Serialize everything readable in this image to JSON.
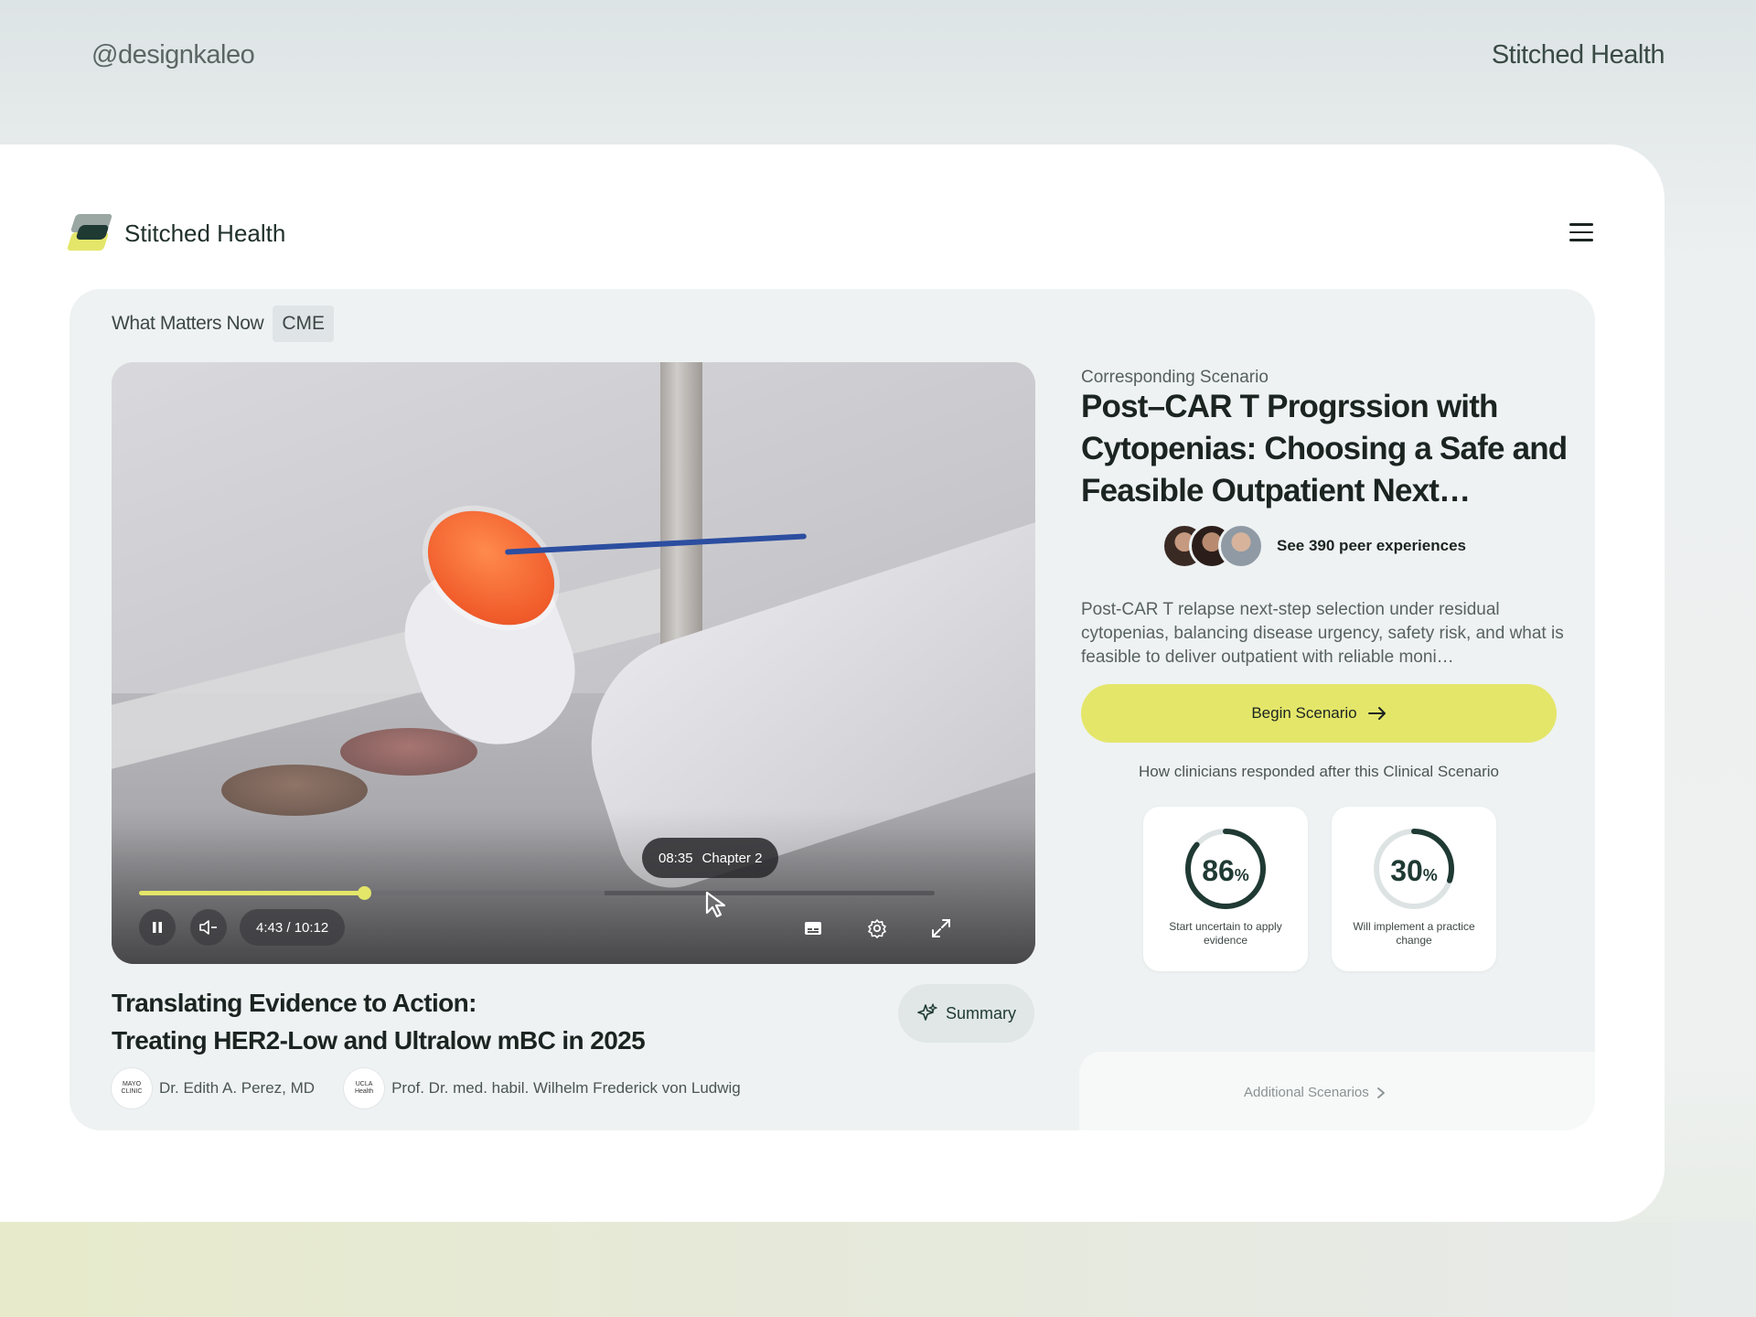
{
  "top": {
    "handle": "@designkaleo",
    "brand": "Stitched Health"
  },
  "header": {
    "app_name": "Stitched Health"
  },
  "section": {
    "title": "What Matters Now",
    "tag": "CME"
  },
  "video": {
    "tooltip_time": "08:35",
    "tooltip_chapter": "Chapter 2",
    "time_display": "4:43 / 10:12",
    "progress": 0.283,
    "hover_position": 0.585
  },
  "talk": {
    "title_line1": "Translating Evidence to Action:",
    "title_line2": "Treating HER2-Low and Ultralow mBC in 2025",
    "summary_label": "Summary",
    "authors": [
      {
        "name": "Dr. Edith A. Perez, MD",
        "badge": "MAYO CLINIC"
      },
      {
        "name": "Prof. Dr. med. habil. Wilhelm Frederick von Ludwig",
        "badge": "UCLA Health"
      }
    ]
  },
  "scenario": {
    "label": "Corresponding Scenario",
    "title": "Post–CAR T Progrssion with Cytopenias: Choosing a Safe and Feasible Outpatient Next…",
    "peers_label": "See 390 peer experiences",
    "description": "Post-CAR T relapse next-step selection under residual cytopenias, balancing disease urgency, safety risk, and what is feasible to deliver outpatient with reliable moni…",
    "begin_label": "Begin Scenario",
    "responded_label": "How clinicians responded after this Clinical Scenario",
    "stats": [
      {
        "value": "86",
        "unit": "%",
        "fraction": 0.86,
        "caption": "Start uncertain to apply evidence"
      },
      {
        "value": "30",
        "unit": "%",
        "fraction": 0.3,
        "caption": "Will implement a practice change"
      }
    ],
    "additional_label": "Additional Scenarios"
  },
  "colors": {
    "accent": "#e4e66a",
    "dark_green": "#1f3a33",
    "panel": "#eef2f2"
  }
}
